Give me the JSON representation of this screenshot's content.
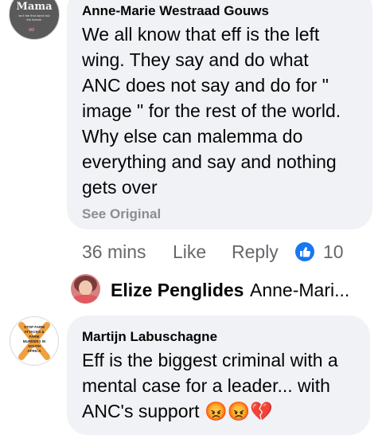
{
  "comment1": {
    "avatar_text": "Mama",
    "avatar_subtext": "isn't the first name but the forever",
    "author": "Anne-Marie Westraad Gouws",
    "text": "We all know that eff is the left\nwing. They say and do what\nANC does not say and do for \"\nimage \" for the rest of the world.\nWhy else can malemma do\neverything and say and nothing\ngets over",
    "see_original": "See Original",
    "time": "36 mins",
    "like_label": "Like",
    "reply_label": "Reply",
    "reaction_count": "10",
    "colors": {
      "like_blue": "#1877f2"
    }
  },
  "reply_preview": {
    "author": "Elize Penglides",
    "text": "Anne-Mari..."
  },
  "comment2": {
    "avatar_text": "STOP FARM ATTACKS & FARM MURDERS IN SOUTH AFRICA",
    "author": "Martijn Labuschagne",
    "text": "Eff is the biggest criminal with a\nmental case for a leader... with\nANC's support",
    "emojis": [
      "😡",
      "😡",
      "💔"
    ]
  }
}
